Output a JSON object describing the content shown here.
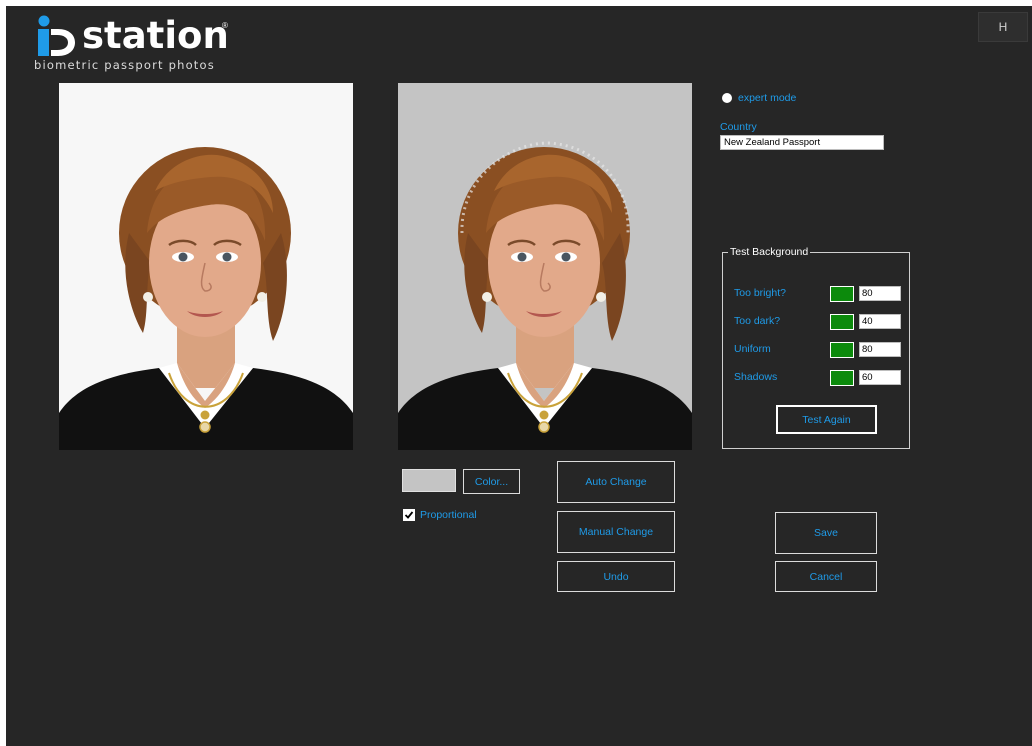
{
  "header": {
    "logo_wordmark": "station",
    "logo_registered": "®",
    "logo_tagline": "biometric passport photos",
    "help_label": "H"
  },
  "options": {
    "expert_mode_label": "expert mode",
    "country_label": "Country",
    "country_value": "New Zealand Passport"
  },
  "test_background": {
    "title": "Test Background",
    "rows": [
      {
        "label": "Too bright?",
        "status_color": "#0c8a0c",
        "value": "80"
      },
      {
        "label": "Too dark?",
        "status_color": "#0c8a0c",
        "value": "40"
      },
      {
        "label": "Uniform",
        "status_color": "#0c8a0c",
        "value": "80"
      },
      {
        "label": "Shadows",
        "status_color": "#0c8a0c",
        "value": "60"
      }
    ],
    "test_again_label": "Test Again"
  },
  "background_controls": {
    "swatch_color": "#c4c4c4",
    "color_button_label": "Color...",
    "proportional_label": "Proportional",
    "proportional_checked": true
  },
  "actions": {
    "auto_change_label": "Auto Change",
    "manual_change_label": "Manual Change",
    "undo_label": "Undo",
    "save_label": "Save",
    "cancel_label": "Cancel"
  },
  "colors": {
    "window_background": "#262626",
    "accent_blue": "#1f9be8",
    "status_green": "#0c8a0c",
    "original_photo_background": "#f7f7f7",
    "processed_photo_background": "#c4c4c4"
  }
}
